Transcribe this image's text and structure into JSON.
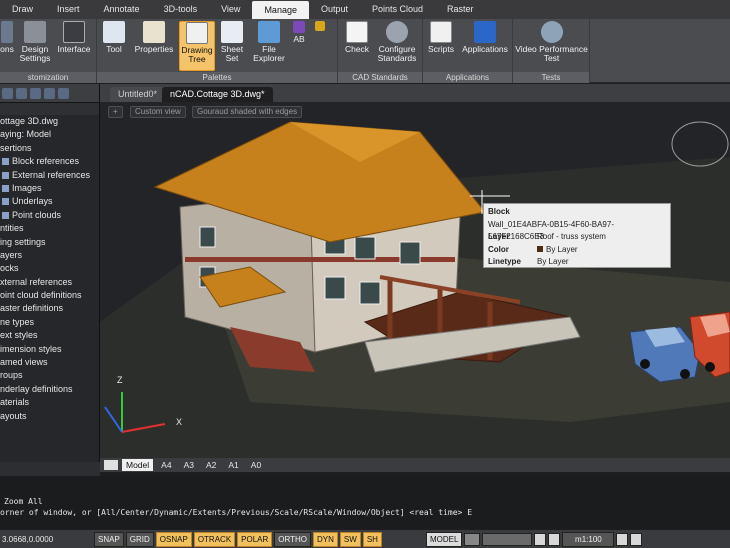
{
  "ribbon": {
    "tabs": [
      "Draw",
      "Insert",
      "Annotate",
      "3D-tools",
      "View",
      "Manage",
      "Output",
      "Points Cloud",
      "Raster"
    ],
    "active_tab": "Manage",
    "groups": {
      "customization": {
        "title": "stomization",
        "buttons": [
          "Options",
          "Design Settings",
          "Interface"
        ]
      },
      "palettes": {
        "title": "Palettes",
        "buttons": [
          "Tool",
          "Properties",
          "Drawing Tree",
          "Sheet Set",
          "File Explorer"
        ]
      },
      "cad_standards": {
        "title": "CAD Standards",
        "buttons": [
          "Check",
          "Configure Standards"
        ]
      },
      "applications": {
        "title": "Applications",
        "buttons": [
          "Scripts",
          "Applications"
        ]
      },
      "tests": {
        "title": "Tests",
        "buttons": [
          "Video Performance Test"
        ]
      }
    },
    "partial_labels": {
      "options": "ons",
      "design_settings": "Design Settings",
      "interface": "Interface",
      "ab_icon_text": "AB"
    }
  },
  "left_panel": {
    "tree": [
      "ottage 3D.dwg",
      "aying: Model",
      "sertions",
      "Block references",
      "External references",
      "Images",
      "Underlays",
      "Point clouds",
      "ntities",
      "ing settings",
      "ayers",
      "ocks",
      "xternal references",
      "oint cloud definitions",
      "aster definitions",
      "ne types",
      "ext styles",
      "imension styles",
      "amed views",
      "roups",
      "nderlay definitions",
      "aterials",
      "ayouts"
    ]
  },
  "documents": {
    "tabs": [
      "Untitled0*",
      "nCAD.Cottage 3D.dwg*"
    ],
    "active": "nCAD.Cottage 3D.dwg*"
  },
  "viewport": {
    "controls": [
      "+",
      "Custom view",
      "Gouraud shaded with edges"
    ],
    "axis_labels": {
      "z": "Z",
      "x": "X"
    }
  },
  "tooltip": {
    "title": "Block",
    "name": "Wall_01E4ABFA-0B15-4F60-BA97-567F2168C6E3",
    "rows": [
      {
        "key": "Layer",
        "value": "Roof - truss system"
      },
      {
        "key": "Color",
        "value": "By Layer"
      },
      {
        "key": "Linetype",
        "value": "By Layer"
      }
    ],
    "swatch_color": "#4b2c12"
  },
  "layout_tabs": [
    "Model",
    "A4",
    "A3",
    "A2",
    "A1",
    "A0"
  ],
  "command": {
    "lines": [
      "Zoom All",
      "orner of window, or [All/Center/Dynamic/Extents/Previous/Scale/RScale/Window/Object] <real time> E"
    ]
  },
  "status": {
    "coords": "3.0668,0.0000",
    "toggles": [
      "SNAP",
      "GRID",
      "OSNAP",
      "OTRACK",
      "POLAR",
      "ORTHO",
      "DYN",
      "SW",
      "SH"
    ],
    "on": [
      "OSNAP",
      "OTRACK",
      "POLAR",
      "DYN",
      "SW",
      "SH"
    ],
    "mode": "MODEL",
    "scale": "m1:100"
  },
  "colors": {
    "accent": "#f5c36a",
    "roof": "#c6801c",
    "wall": "#b9b0a4",
    "car_blue": "#4f79b8",
    "car_red": "#d24a2e"
  }
}
